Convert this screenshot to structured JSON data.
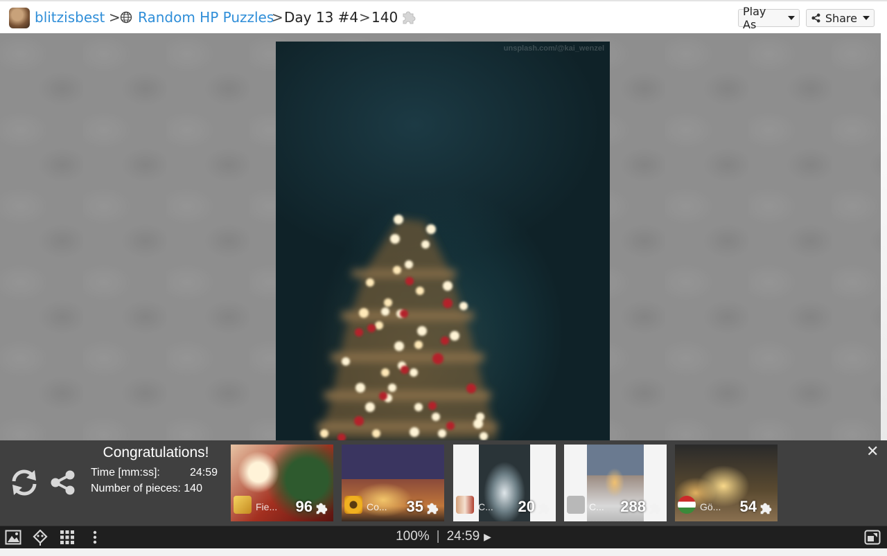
{
  "header": {
    "user": "blitzisbest",
    "collection": "Random HP Puzzles",
    "puzzle_title": "Day 13 #4",
    "piece_count": "140",
    "separator": ">",
    "play_as_label": "Play As",
    "share_label": "Share"
  },
  "image": {
    "credit": "unsplash.com/@kai_wenzel"
  },
  "completion": {
    "title": "Congratulations!",
    "time_label": "Time [mm:ss]:",
    "time_value": "24:59",
    "pieces_label": "Number of pieces: 140"
  },
  "suggestions": [
    {
      "name": "Fie...",
      "count": "96"
    },
    {
      "name": "Co...",
      "count": "35"
    },
    {
      "name": "C...",
      "count": "20"
    },
    {
      "name": "C...",
      "count": "288"
    },
    {
      "name": "Gö...",
      "count": "54"
    }
  ],
  "statusbar": {
    "zoom": "100%",
    "divider": "|",
    "timer": "24:59",
    "play_symbol": "▶"
  },
  "colors": {
    "link": "#2f8ed8",
    "panel_bg": "#3a3a3a",
    "statusbar_bg": "#1f1f1f"
  },
  "icons": [
    "globe-icon",
    "puzzle-piece-icon",
    "caret-down-icon",
    "share-icon",
    "refresh-icon",
    "close-icon",
    "image-icon",
    "ghost-icon",
    "grid-icon",
    "more-icon",
    "fullscreen-icon"
  ]
}
